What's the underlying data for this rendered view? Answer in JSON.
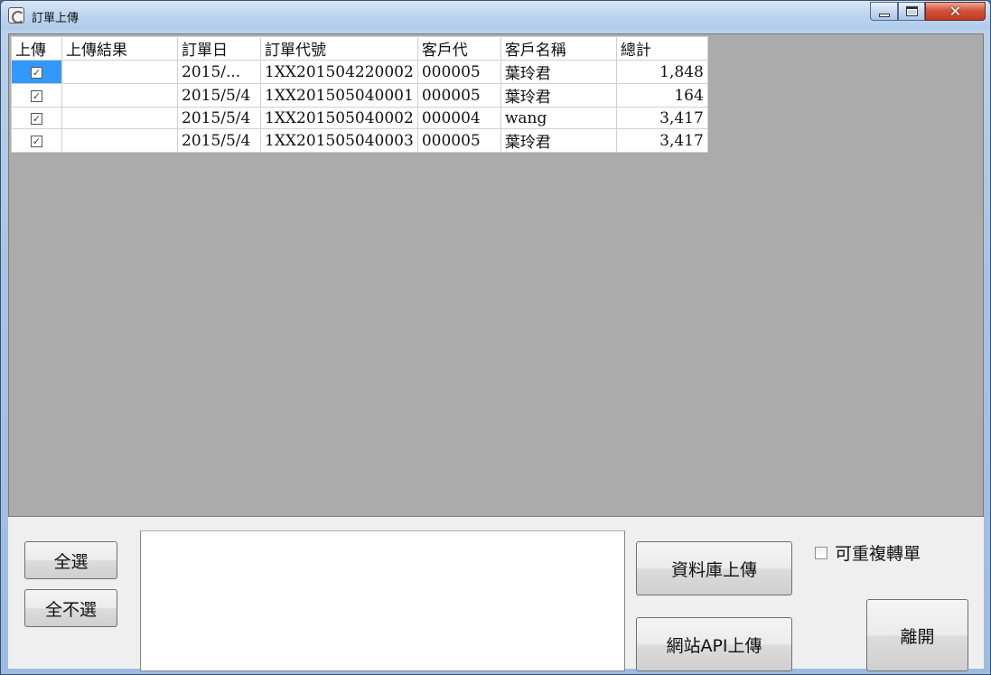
{
  "window": {
    "title": "訂單上傳",
    "close_glyph": "✕"
  },
  "grid": {
    "columns": [
      "上傳",
      "上傳結果",
      "訂單日",
      "訂單代號",
      "客戶代",
      "客戶名稱",
      "總計"
    ],
    "rows": [
      {
        "checked": true,
        "result": "",
        "date": "2015/...",
        "order_no": "1XX201504220002",
        "cust_code": "000005",
        "cust_name": "葉玲君",
        "total": "1,848"
      },
      {
        "checked": true,
        "result": "",
        "date": "2015/5/4",
        "order_no": "1XX201505040001",
        "cust_code": "000005",
        "cust_name": "葉玲君",
        "total": "164"
      },
      {
        "checked": true,
        "result": "",
        "date": "2015/5/4",
        "order_no": "1XX201505040002",
        "cust_code": "000004",
        "cust_name": "wang",
        "total": "3,417"
      },
      {
        "checked": true,
        "result": "",
        "date": "2015/5/4",
        "order_no": "1XX201505040003",
        "cust_code": "000005",
        "cust_name": "葉玲君",
        "total": "3,417"
      }
    ],
    "check_glyph": "✓"
  },
  "buttons": {
    "select_all": "全選",
    "select_none": "全不選",
    "db_upload": "資料庫上傳",
    "api_upload": "網站API上傳",
    "exit": "離開"
  },
  "options": {
    "allow_repeat_label": "可重複轉單",
    "allow_repeat_checked": false
  }
}
